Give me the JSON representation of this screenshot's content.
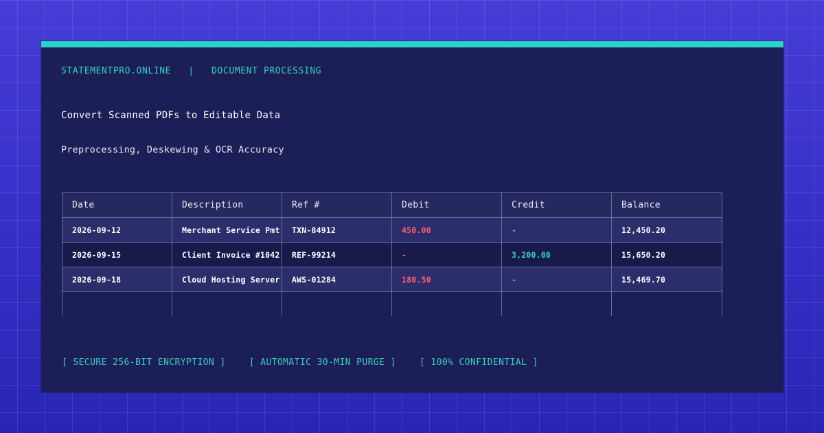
{
  "header": {
    "site": "STATEMENTPRO.ONLINE",
    "separator": "|",
    "section": "DOCUMENT PROCESSING"
  },
  "hero": {
    "title": "Convert Scanned PDFs to Editable Data",
    "subtitle": "Preprocessing, Deskewing & OCR Accuracy"
  },
  "table": {
    "columns": [
      "Date",
      "Description",
      "Ref #",
      "Debit",
      "Credit",
      "Balance"
    ],
    "rows": [
      {
        "date": "2026-09-12",
        "description": "Merchant Service Pmt",
        "ref": "TXN-84912",
        "debit": "450.00",
        "credit": "-",
        "balance": "12,450.20"
      },
      {
        "date": "2026-09-15",
        "description": "Client Invoice #1042",
        "ref": "REF-99214",
        "debit": "-",
        "credit": "3,200.00",
        "balance": "15,650.20"
      },
      {
        "date": "2026-09-18",
        "description": "Cloud Hosting Server",
        "ref": "AWS-01284",
        "debit": "180.50",
        "credit": "-",
        "balance": "15,469.70"
      }
    ]
  },
  "footer": {
    "badges": [
      "[ SECURE 256-BIT ENCRYPTION ]",
      "[ AUTOMATIC 30-MIN PURGE ]",
      "[ 100% CONFIDENTIAL ]"
    ]
  },
  "colors": {
    "accent": "#2bd4c6",
    "debit": "#ff5f6d",
    "credit": "#36d3bd",
    "card": "#1c1f57",
    "background": "#3a35c9"
  }
}
